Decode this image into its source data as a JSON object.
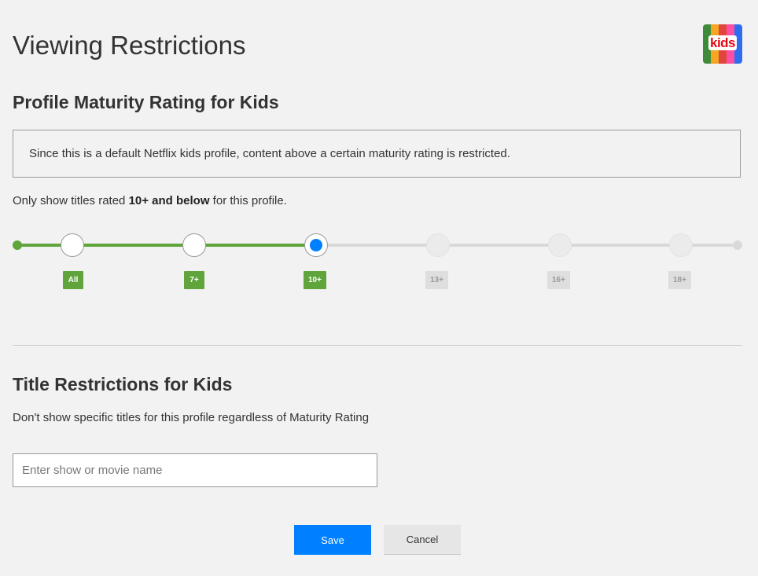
{
  "page": {
    "title": "Viewing Restrictions"
  },
  "profile_badge": {
    "label": "kids",
    "icon": "kids-profile-icon",
    "stripe_colors": [
      "#3f8a3a",
      "#f5a623",
      "#e2453c",
      "#ff4fa3",
      "#2f6df0"
    ]
  },
  "maturity": {
    "heading": "Profile Maturity Rating for Kids",
    "notice": "Since this is a default Netflix kids profile, content above a certain maturity rating is restricted.",
    "sentence_prefix": "Only show titles rated ",
    "sentence_value": "10+ and below",
    "sentence_suffix": " for this profile.",
    "selected_rating": "10+",
    "ratings": [
      {
        "label": "All",
        "state": "allowed"
      },
      {
        "label": "7+",
        "state": "allowed"
      },
      {
        "label": "10+",
        "state": "selected"
      },
      {
        "label": "13+",
        "state": "restricted"
      },
      {
        "label": "16+",
        "state": "restricted"
      },
      {
        "label": "18+",
        "state": "restricted"
      }
    ],
    "colors": {
      "allowed": "#5fa53b",
      "selected_dot": "#0080ff",
      "restricted": "#dedede"
    }
  },
  "title_restrictions": {
    "heading": "Title Restrictions for Kids",
    "description": "Don't show specific titles for this profile regardless of Maturity Rating",
    "input_value": "",
    "input_placeholder": "Enter show or movie name"
  },
  "actions": {
    "save_label": "Save",
    "cancel_label": "Cancel",
    "save_color": "#0080ff"
  }
}
